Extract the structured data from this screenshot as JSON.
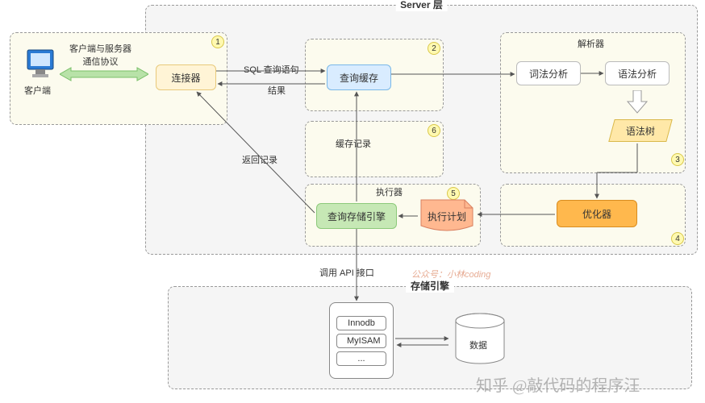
{
  "title_server": "Server 层",
  "title_storage": "存储引擎",
  "client_section": {
    "label_client": "客户端",
    "protocol_label": "客户端与服务器\n通信协议"
  },
  "nodes": {
    "connector": "连接器",
    "query_cache": "查询缓存",
    "parser_title": "解析器",
    "lexer": "词法分析",
    "syntax": "语法分析",
    "syntax_tree": "语法树",
    "optimizer": "优化器",
    "exec_plan": "执行计划",
    "exec_title": "执行器",
    "query_engine": "查询存储引擎",
    "cache_record": "缓存记录",
    "return_record": "返回记录",
    "sql_stmt": "SQL 查询语句",
    "result": "结果",
    "api_call": "调用 API 接口",
    "data": "数据"
  },
  "engines": {
    "e1": "Innodb",
    "e2": "MyISAM",
    "e3": "..."
  },
  "badges": {
    "b1": "1",
    "b2": "2",
    "b3": "3",
    "b4": "4",
    "b5": "5",
    "b6": "6"
  },
  "watermark": "公众号：小林coding",
  "watermark2": "知乎 @敲代码的程序汪"
}
